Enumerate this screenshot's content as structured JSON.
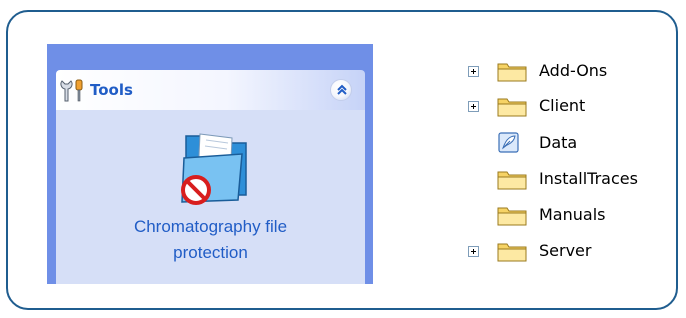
{
  "tools_panel": {
    "title": "Tools",
    "title_icon": "wrench-screwdriver-icon",
    "collapse_icon": "chevron-up-double-icon",
    "task": {
      "label_line1": "Chromatography file",
      "label_line2": "protection",
      "icon": "protected-folder-icon"
    }
  },
  "folder_tree": {
    "nodes": [
      {
        "label": "Add-Ons",
        "icon": "folder-icon",
        "expandable": true
      },
      {
        "label": "Client",
        "icon": "folder-icon",
        "expandable": true
      },
      {
        "label": "Data",
        "icon": "data-file-icon",
        "expandable": false
      },
      {
        "label": "InstallTraces",
        "icon": "folder-icon",
        "expandable": false
      },
      {
        "label": "Manuals",
        "icon": "folder-icon",
        "expandable": false
      },
      {
        "label": "Server",
        "icon": "folder-icon",
        "expandable": true
      }
    ]
  },
  "colors": {
    "frame_border": "#1f5d8f",
    "pane_background": "#6f8fe7",
    "panel_body": "#d6dff7",
    "link_text": "#215dc6",
    "folder_yellow": "#f6d365"
  }
}
